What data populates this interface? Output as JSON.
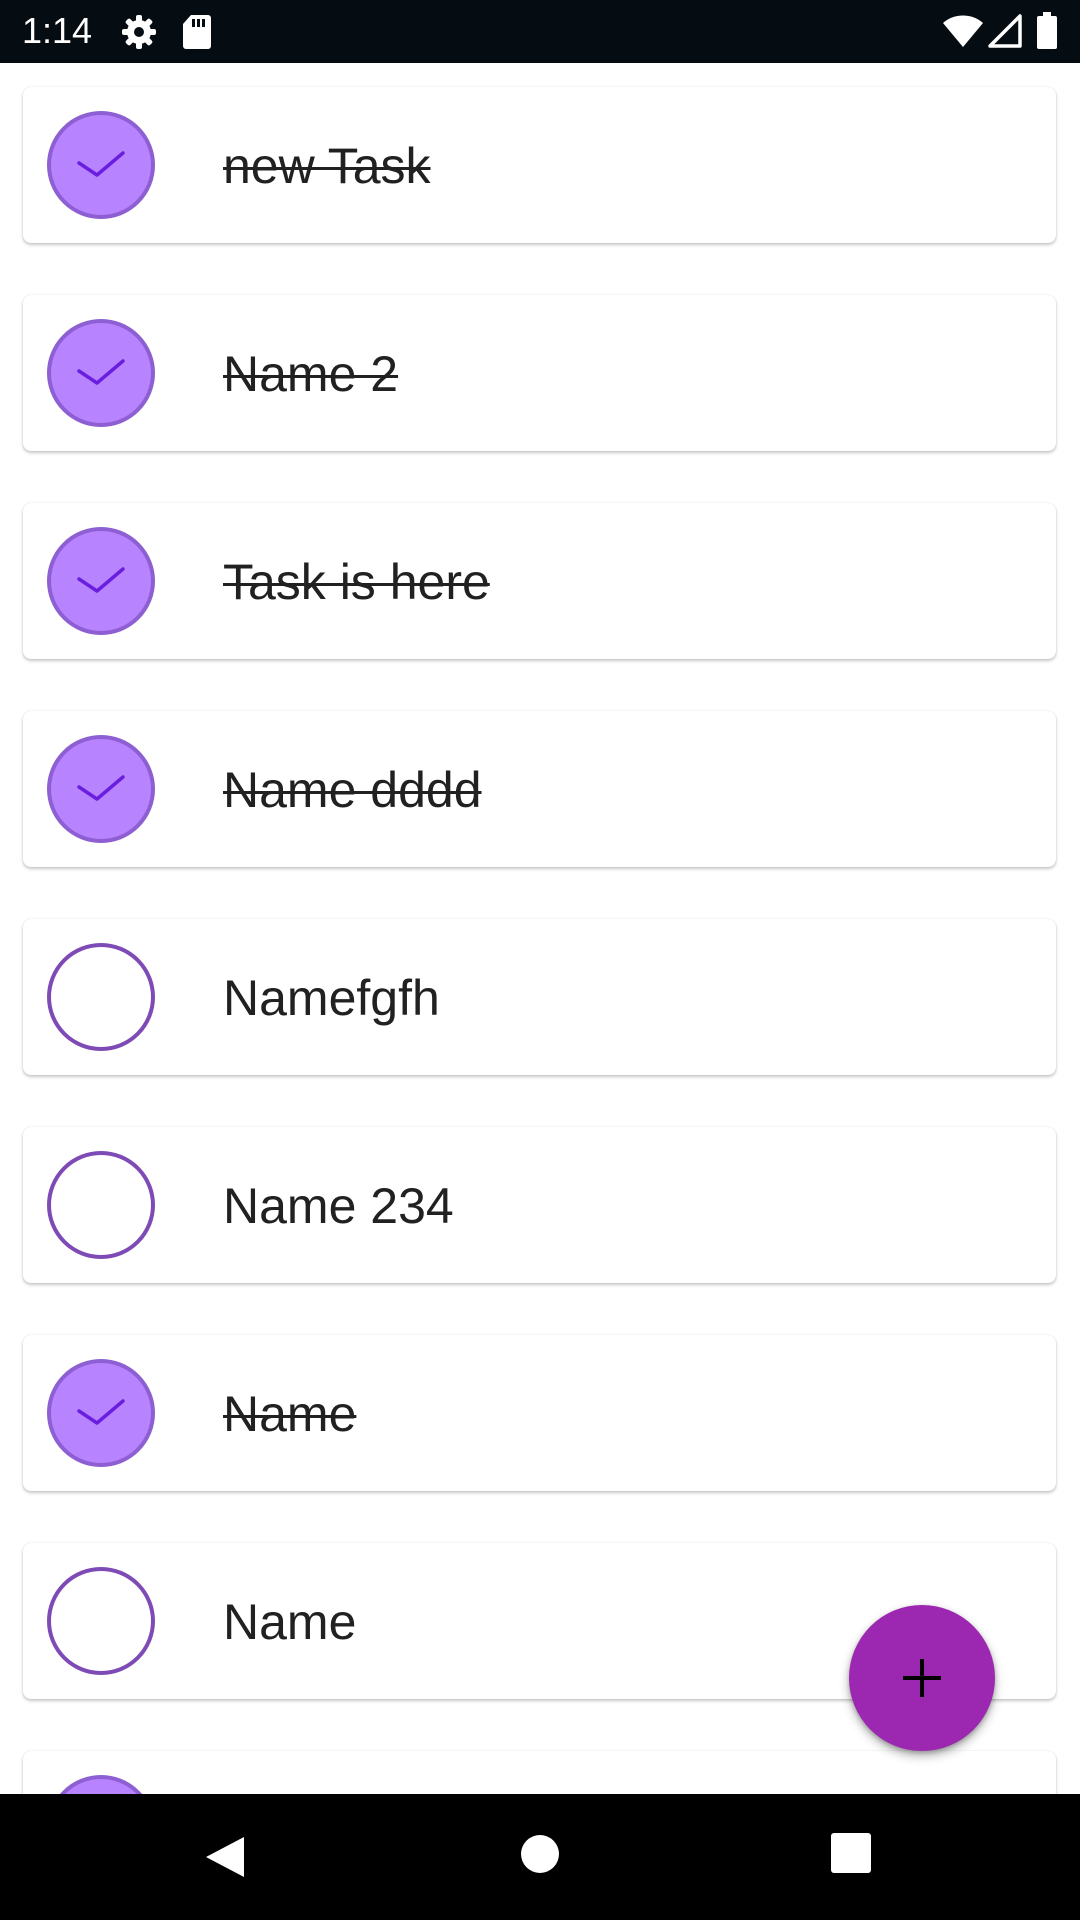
{
  "status_bar": {
    "time": "1:14",
    "icons": [
      "settings-icon",
      "sd-card-icon",
      "wifi-icon",
      "cell-signal-icon",
      "battery-icon"
    ]
  },
  "tasks": [
    {
      "label": "new Task",
      "done": true
    },
    {
      "label": "Name 2",
      "done": true
    },
    {
      "label": "Task is here",
      "done": true
    },
    {
      "label": "Name dddd",
      "done": true
    },
    {
      "label": "Namefgfh",
      "done": false
    },
    {
      "label": "Name 234",
      "done": false
    },
    {
      "label": "Name",
      "done": true
    },
    {
      "label": "Name",
      "done": false
    },
    {
      "label": "",
      "done": true
    }
  ],
  "fab": {
    "icon": "plus-icon"
  },
  "nav_bar": {
    "icons": [
      "back-icon",
      "home-icon",
      "recents-icon"
    ]
  },
  "colors": {
    "checked_fill": "#b783ff",
    "checked_border": "#8d5fd3",
    "unchecked_border": "#7e4bb6",
    "checkmark": "#6a1fe0",
    "fab": "#9c27b0"
  }
}
